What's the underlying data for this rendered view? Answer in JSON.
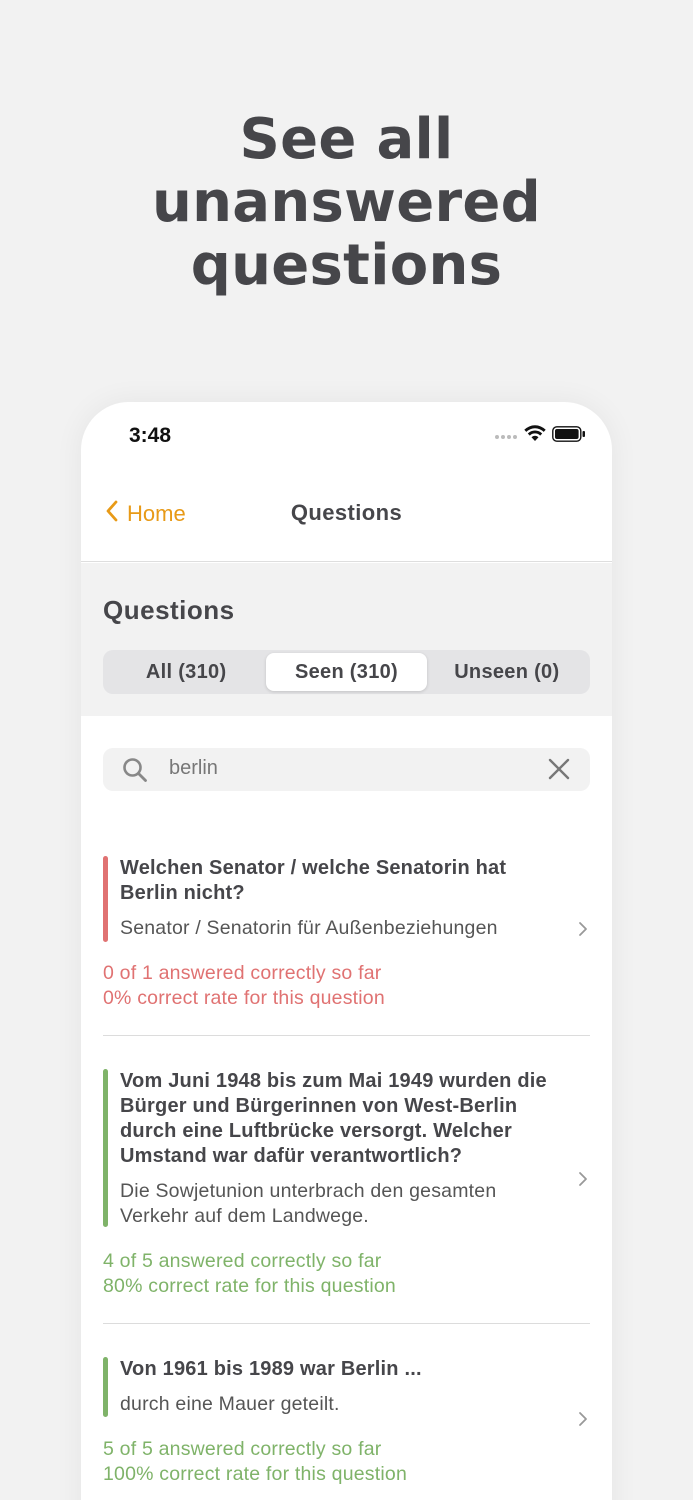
{
  "headline": [
    "See all",
    "unanswered",
    "questions"
  ],
  "status_bar": {
    "time": "3:48",
    "icons": [
      "signal-dots-icon",
      "wifi-icon",
      "battery-icon"
    ]
  },
  "nav": {
    "back_label": "Home",
    "title": "Questions"
  },
  "section_title": "Questions",
  "segments": [
    {
      "label": "All (310)",
      "active": false
    },
    {
      "label": "Seen (310)",
      "active": true
    },
    {
      "label": "Unseen (0)",
      "active": false
    }
  ],
  "search": {
    "value": "berlin"
  },
  "questions": [
    {
      "question": "Welchen Senator / welche Senatorin hat Berlin nicht?",
      "answer": "Senator / Senatorin für Außenbeziehungen",
      "stat_answered": "0 of 1 answered correctly so far",
      "stat_rate": "0% correct rate for this question",
      "status": "wrong",
      "color": "#e07272"
    },
    {
      "question": "Vom Juni 1948 bis zum Mai 1949 wurden die Bürger und Bürgerinnen von West-Berlin durch eine Luftbrücke versorgt. Welcher Umstand war dafür verantwortlich?",
      "answer": "Die Sowjetunion unterbrach den gesamten Verkehr auf dem Landwege.",
      "stat_answered": "4 of 5 answered correctly so far",
      "stat_rate": "80% correct rate for this question",
      "status": "correct",
      "color": "#7fb369"
    },
    {
      "question": "Von 1961 bis 1989 war Berlin ...",
      "answer": "durch eine Mauer geteilt.",
      "stat_answered": "5 of 5 answered correctly so far",
      "stat_rate": "100% correct rate for this question",
      "status": "correct",
      "color": "#7fb369"
    }
  ],
  "colors": {
    "accent": "#e89a17",
    "wrong": "#e07272",
    "correct": "#7fb369"
  }
}
